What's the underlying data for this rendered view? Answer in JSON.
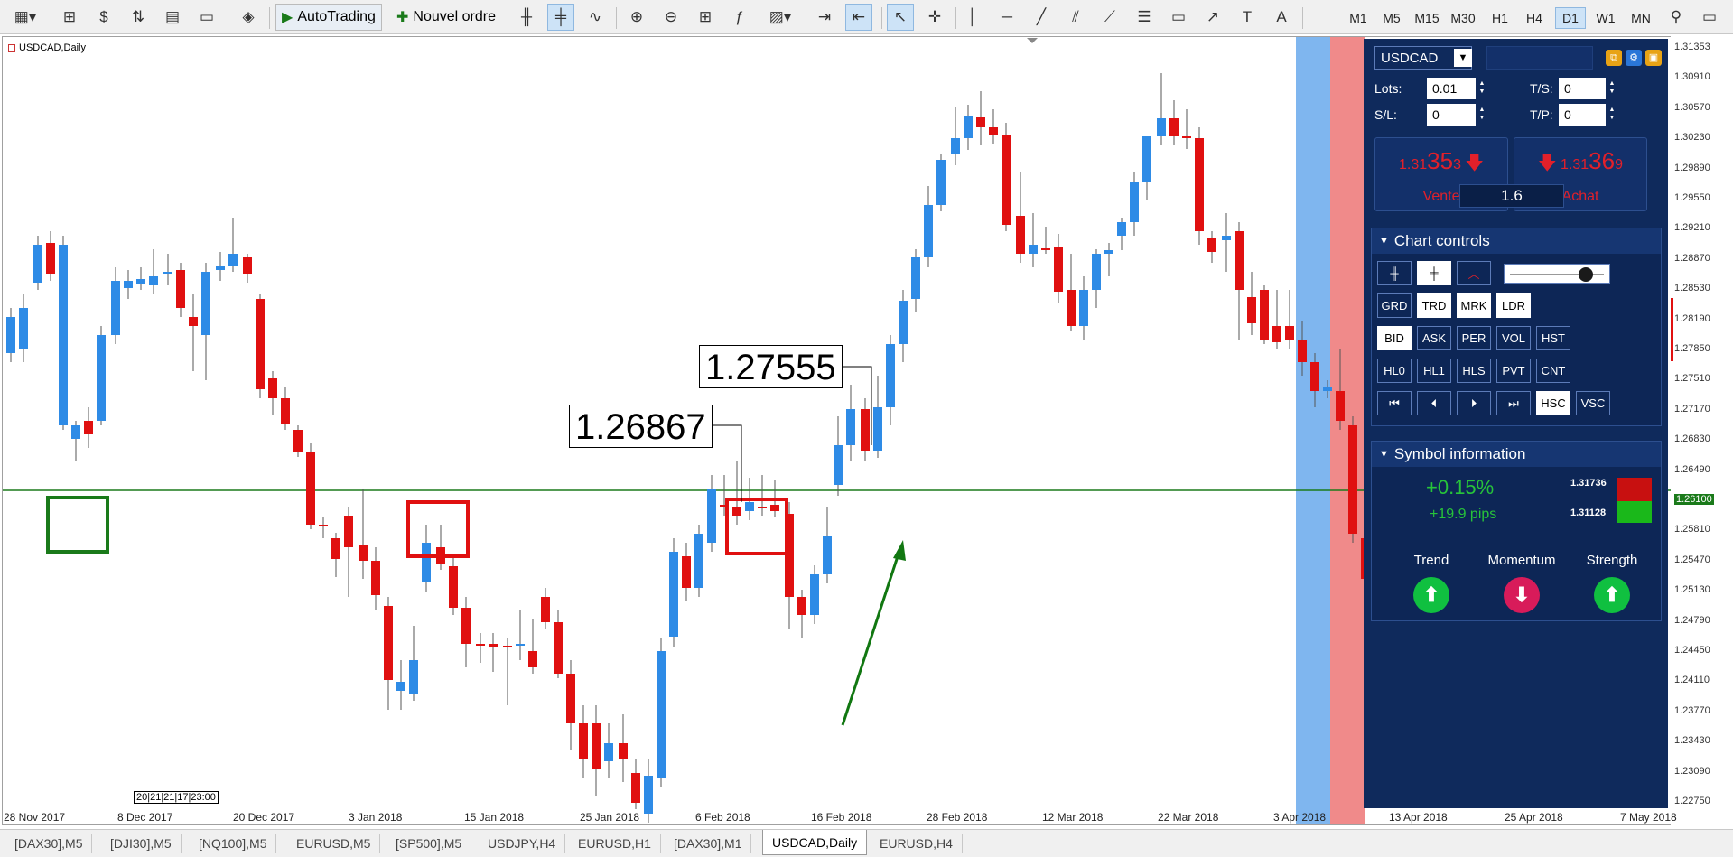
{
  "toolbar": {
    "autotrading_label": "AutoTrading",
    "new_order_label": "Nouvel ordre",
    "timeframes": [
      "M1",
      "M5",
      "M15",
      "M30",
      "H1",
      "H4",
      "D1",
      "W1",
      "MN"
    ],
    "active_timeframe": "D1"
  },
  "chart": {
    "symbol_title": "USDCAD,Daily",
    "price_labels": [
      "1.31353",
      "1.30910",
      "1.30570",
      "1.30230",
      "1.29890",
      "1.29550",
      "1.29210",
      "1.28870",
      "1.28530",
      "1.28190",
      "1.27850",
      "1.27510",
      "1.27170",
      "1.26830",
      "1.26490",
      "1.26100",
      "1.25810",
      "1.25470",
      "1.25130",
      "1.24790",
      "1.24450",
      "1.24110",
      "1.23770",
      "1.23430",
      "1.23090",
      "1.22750"
    ],
    "current_price_label": "1.26100",
    "time_labels": [
      "28 Nov 2017",
      "8 Dec 2017",
      "20 Dec 2017",
      "3 Jan 2018",
      "15 Jan 2018",
      "25 Jan 2018",
      "6 Feb 2018",
      "16 Feb 2018",
      "28 Feb 2018",
      "12 Mar 2018",
      "22 Mar 2018",
      "3 Apr 2018",
      "13 Apr 2018",
      "25 Apr 2018",
      "7 May 2018"
    ],
    "session_label": "20|21|21|17|23:00",
    "callout_1": "1.27555",
    "callout_2": "1.26867",
    "colors": {
      "bull": "#2e8be6",
      "bear": "#e01010",
      "hline": "#1a7a1a",
      "arrow": "#117711",
      "zone_blue": "#7fb6ef",
      "zone_red": "#f08a8a"
    }
  },
  "panel": {
    "symbol": "USDCAD",
    "lots_label": "Lots:",
    "lots_value": "0.01",
    "ts_label": "T/S:",
    "ts_value": "0",
    "sl_label": "S/L:",
    "sl_value": "0",
    "tp_label": "T/P:",
    "tp_value": "0",
    "sell": {
      "prefix": "1.31",
      "big": "35",
      "suffix": "3",
      "label": "Vente"
    },
    "buy": {
      "prefix": "1.31",
      "big": "36",
      "suffix": "9",
      "label": "Achat"
    },
    "spread": "1.6",
    "chart_controls_title": "Chart controls",
    "row2": [
      "GRD",
      "TRD",
      "MRK",
      "LDR"
    ],
    "row3": [
      "BID",
      "ASK",
      "PER",
      "VOL",
      "HST"
    ],
    "row4": [
      "HL0",
      "HL1",
      "HLS",
      "PVT",
      "CNT"
    ],
    "row5_toggle": [
      "HSC",
      "VSC"
    ],
    "symbol_info_title": "Symbol information",
    "change_pct": "+0.15%",
    "change_pips": "+19.9 pips",
    "range_high": "1.31736",
    "range_low": "1.31128",
    "indicators": [
      {
        "label": "Trend",
        "direction": "up"
      },
      {
        "label": "Momentum",
        "direction": "down"
      },
      {
        "label": "Strength",
        "direction": "up"
      }
    ]
  },
  "tabs": [
    "[DAX30],M5",
    "[DJI30],M5",
    "[NQ100],M5",
    "EURUSD,M5",
    "[SP500],M5",
    "USDJPY,H4",
    "EURUSD,H1",
    "[DAX30],M1",
    "USDCAD,Daily",
    "EURUSD,H4"
  ],
  "active_tab": "USDCAD,Daily"
}
